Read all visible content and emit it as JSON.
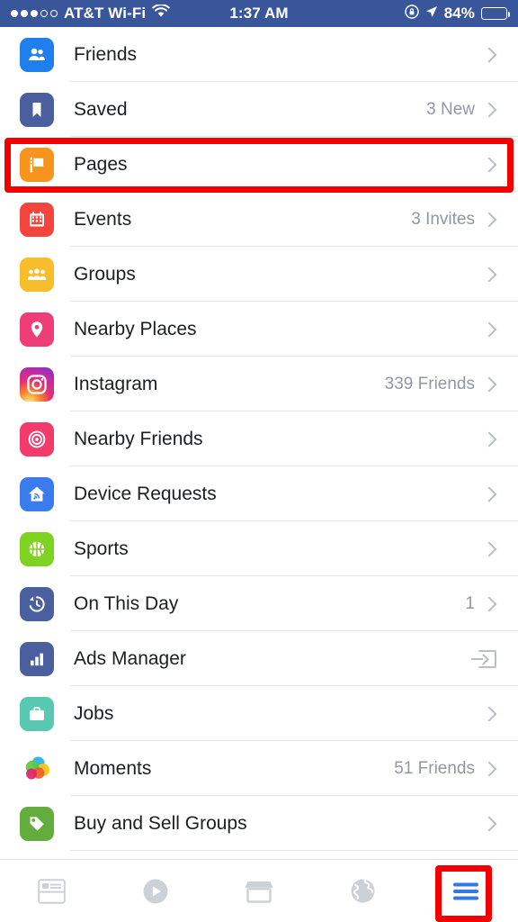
{
  "status_bar": {
    "signal_dots_filled": 3,
    "signal_dots_empty": 2,
    "carrier": "AT&T Wi-Fi",
    "wifi_icon": "wifi-icon",
    "time": "1:37 AM",
    "rotation_lock_icon": "rotation-lock-icon",
    "location_icon": "location-arrow-icon",
    "battery_percent": "84%",
    "battery_level": 84,
    "background_color": "#3a569b",
    "text_color": "#ffffff"
  },
  "menu": {
    "items": [
      {
        "label": "Friends",
        "meta": "",
        "icon": "friends-icon",
        "accessory": "chevron",
        "color": "#1f7fec"
      },
      {
        "label": "Saved",
        "meta": "3 New",
        "icon": "bookmark-icon",
        "accessory": "chevron",
        "color": "#4a5f9e"
      },
      {
        "label": "Pages",
        "meta": "",
        "icon": "flag-icon",
        "accessory": "chevron",
        "color": "#f7941e",
        "highlighted": true
      },
      {
        "label": "Events",
        "meta": "3 Invites",
        "icon": "calendar-icon",
        "accessory": "chevron",
        "color": "#f4453c"
      },
      {
        "label": "Groups",
        "meta": "",
        "icon": "groups-icon",
        "accessory": "chevron",
        "color": "#f7bd2b"
      },
      {
        "label": "Nearby Places",
        "meta": "",
        "icon": "map-pin-icon",
        "accessory": "chevron",
        "color": "#ee3d77"
      },
      {
        "label": "Instagram",
        "meta": "339 Friends",
        "icon": "instagram-icon",
        "accessory": "chevron",
        "color": "#c9338e"
      },
      {
        "label": "Nearby Friends",
        "meta": "",
        "icon": "nearby-friends-icon",
        "accessory": "chevron",
        "color": "#f23b6b"
      },
      {
        "label": "Device Requests",
        "meta": "",
        "icon": "device-request-icon",
        "accessory": "chevron",
        "color": "#3a7ced"
      },
      {
        "label": "Sports",
        "meta": "",
        "icon": "sports-ball-icon",
        "accessory": "chevron",
        "color": "#7ed321"
      },
      {
        "label": "On This Day",
        "meta": "1",
        "icon": "clock-rewind-icon",
        "accessory": "chevron",
        "color": "#4a5f9e"
      },
      {
        "label": "Ads Manager",
        "meta": "",
        "icon": "bar-chart-icon",
        "accessory": "external-link",
        "color": "#4a5f9e"
      },
      {
        "label": "Jobs",
        "meta": "",
        "icon": "briefcase-icon",
        "accessory": "chevron",
        "color": "#58c9b0"
      },
      {
        "label": "Moments",
        "meta": "51 Friends",
        "icon": "moments-icon",
        "accessory": "chevron",
        "color": "#ffffff"
      },
      {
        "label": "Buy and Sell Groups",
        "meta": "",
        "icon": "price-tag-icon",
        "accessory": "chevron",
        "color": "#63ac3e"
      }
    ]
  },
  "tabbar": {
    "items": [
      {
        "name": "news-feed-tab",
        "icon": "news-feed-icon",
        "active": false
      },
      {
        "name": "watch-tab",
        "icon": "play-circle-icon",
        "active": false
      },
      {
        "name": "marketplace-tab",
        "icon": "storefront-icon",
        "active": false
      },
      {
        "name": "notifications-tab",
        "icon": "globe-icon",
        "active": false
      },
      {
        "name": "menu-tab",
        "icon": "hamburger-menu-icon",
        "active": true
      }
    ],
    "active_color": "#3578e5",
    "inactive_color": "#ccd0d7"
  },
  "annotations": {
    "highlight_color": "#f50000",
    "highlighted_row": "Pages",
    "highlighted_tab": "menu-tab"
  }
}
